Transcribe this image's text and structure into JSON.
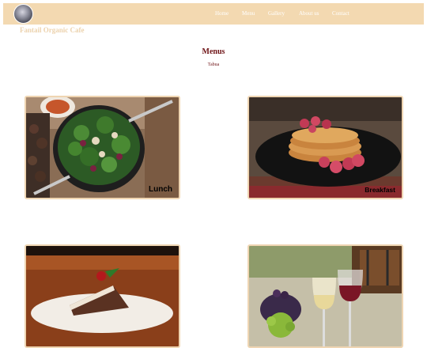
{
  "brand": {
    "name": "Fantail Organic Cafe",
    "logo_icon": "fantail-logo-icon"
  },
  "nav": {
    "items": [
      "Home",
      "Menu",
      "Gallery",
      "About us",
      "Contact"
    ]
  },
  "page": {
    "title": "Menus",
    "subtitle": "Tabua"
  },
  "cards": [
    {
      "label": "Lunch",
      "image": "salad-bowl-image"
    },
    {
      "label": "Breakfast",
      "image": "pancakes-raspberries-image"
    },
    {
      "label": "",
      "image": "chocolate-cake-image"
    },
    {
      "label": "",
      "image": "wine-grapes-image"
    }
  ],
  "colors": {
    "nav_bg": "#f3d9b1",
    "title": "#6e1316",
    "card_border": "#efd5b2"
  }
}
